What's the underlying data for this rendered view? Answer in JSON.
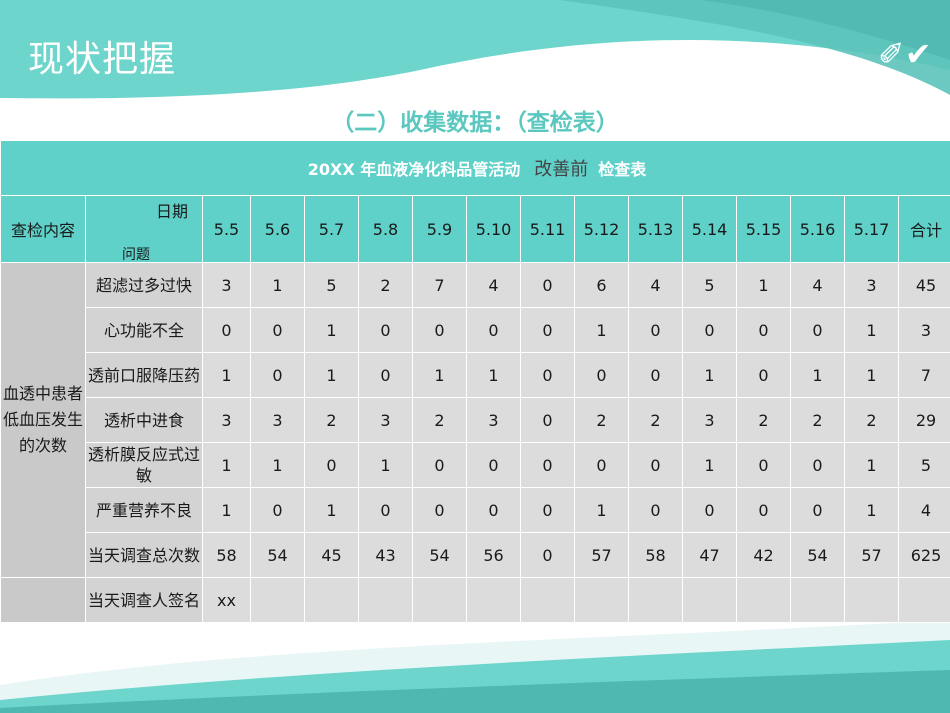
{
  "slide": {
    "title": "现状把握",
    "subtitle": "（二）收集数据：（查检表）",
    "icon": "pencil-check-icon"
  },
  "table": {
    "title_main": "20XX 年血液净化科品管活动",
    "title_accent": "改善前",
    "title_suffix": "检查表",
    "head_label": "查检内容",
    "diag_top": "日期",
    "diag_bottom": "问题",
    "dates": [
      "5.5",
      "5.6",
      "5.7",
      "5.8",
      "5.9",
      "5.10",
      "5.11",
      "5.12",
      "5.13",
      "5.14",
      "5.15",
      "5.16",
      "5.17",
      "合计"
    ],
    "category": "血透中患者低血压发生的次数",
    "rows": [
      {
        "issue": "超滤过多过快",
        "values": [
          "3",
          "1",
          "5",
          "2",
          "7",
          "4",
          "0",
          "6",
          "4",
          "5",
          "1",
          "4",
          "3",
          "45"
        ]
      },
      {
        "issue": "心功能不全",
        "values": [
          "0",
          "0",
          "1",
          "0",
          "0",
          "0",
          "0",
          "1",
          "0",
          "0",
          "0",
          "0",
          "1",
          "3"
        ]
      },
      {
        "issue": "透前口服降压药",
        "values": [
          "1",
          "0",
          "1",
          "0",
          "1",
          "1",
          "0",
          "0",
          "0",
          "1",
          "0",
          "1",
          "1",
          "7"
        ]
      },
      {
        "issue": "透析中进食",
        "values": [
          "3",
          "3",
          "2",
          "3",
          "2",
          "3",
          "0",
          "2",
          "2",
          "3",
          "2",
          "2",
          "2",
          "29"
        ]
      },
      {
        "issue": "透析膜反应式过敏",
        "values": [
          "1",
          "1",
          "0",
          "1",
          "0",
          "0",
          "0",
          "0",
          "0",
          "1",
          "0",
          "0",
          "1",
          "5"
        ]
      },
      {
        "issue": "严重营养不良",
        "values": [
          "1",
          "0",
          "1",
          "0",
          "0",
          "0",
          "0",
          "1",
          "0",
          "0",
          "0",
          "0",
          "1",
          "4"
        ]
      },
      {
        "issue": "当天调查总次数",
        "values": [
          "58",
          "54",
          "45",
          "43",
          "54",
          "56",
          "0",
          "57",
          "58",
          "47",
          "42",
          "54",
          "57",
          "625"
        ]
      }
    ],
    "sign_row": {
      "issue": "当天调查人签名",
      "first_value": "xx"
    }
  },
  "colors": {
    "teal": "#5fd1c9",
    "teal_dark": "#4fb8b0",
    "cell_gray": "#dcdcdc",
    "subtitle": "#5bc8c0"
  }
}
